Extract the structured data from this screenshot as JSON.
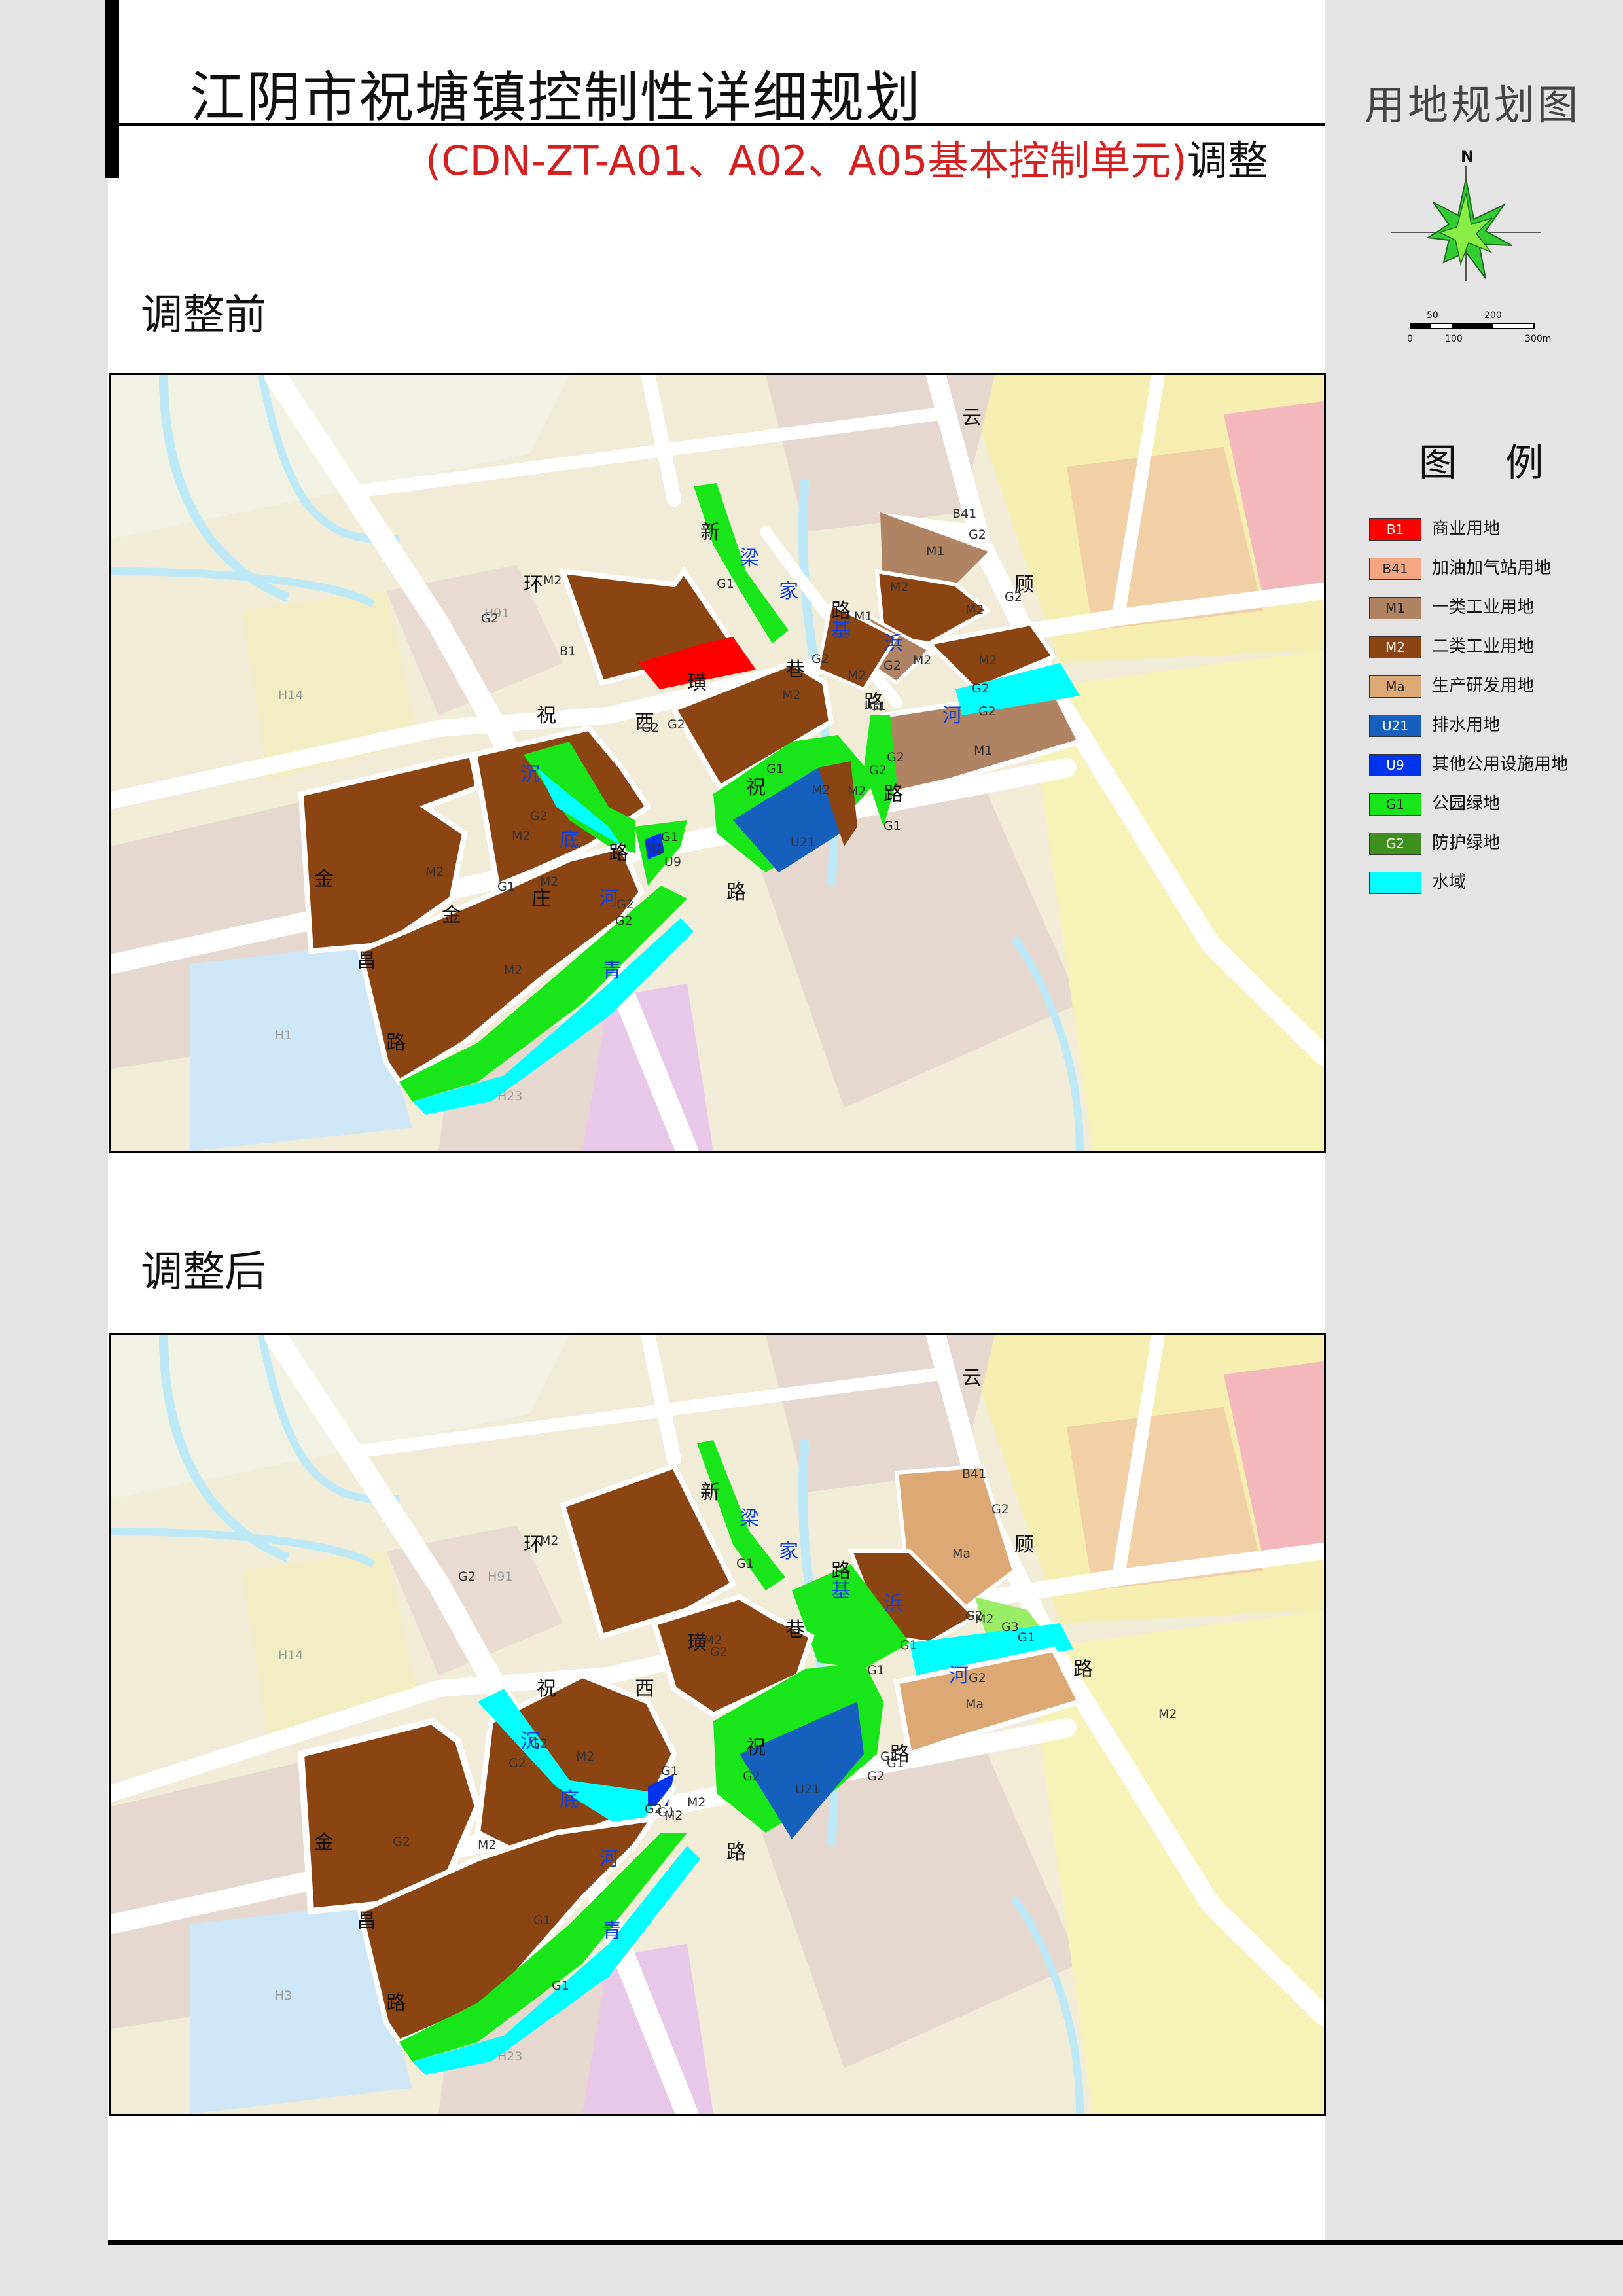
{
  "header": {
    "title": "江阴市祝塘镇控制性详细规划",
    "sheet_type": "用地规划图",
    "subtitle_red": "(CDN-ZT-A01、A02、A05基本控制单元)",
    "subtitle_black": "调整"
  },
  "sections": {
    "before": "调整前",
    "after": "调整后"
  },
  "compass": {
    "north": "N"
  },
  "scale_bar": {
    "top_labels": [
      "50",
      "200"
    ],
    "bottom_labels": [
      "0",
      "100",
      "300m"
    ]
  },
  "legend": {
    "title": "图 例",
    "items": [
      {
        "code": "B1",
        "label": "商业用地",
        "color": "#ff0000",
        "text_color": "#ffffff"
      },
      {
        "code": "B41",
        "label": "加油加气站用地",
        "color": "#f4a582",
        "text_color": "#222222"
      },
      {
        "code": "M1",
        "label": "一类工业用地",
        "color": "#b08462",
        "text_color": "#222222"
      },
      {
        "code": "M2",
        "label": "二类工业用地",
        "color": "#8b4513",
        "text_color": "#ffffff"
      },
      {
        "code": "Ma",
        "label": "生产研发用地",
        "color": "#dca874",
        "text_color": "#222222"
      },
      {
        "code": "U21",
        "label": "排水用地",
        "color": "#1560bd",
        "text_color": "#ffffff"
      },
      {
        "code": "U9",
        "label": "其他公用设施用地",
        "color": "#0033ee",
        "text_color": "#ffffff"
      },
      {
        "code": "G1",
        "label": "公园绿地",
        "color": "#19e619",
        "text_color": "#222222"
      },
      {
        "code": "G2",
        "label": "防护绿地",
        "color": "#3f8f1f",
        "text_color": "#ffffff"
      },
      {
        "code": "",
        "label": "水域",
        "color": "#00ffff",
        "text_color": "#222222"
      }
    ]
  },
  "map_before": {
    "road_chars": [
      {
        "t": "云"
      },
      {
        "t": "新"
      },
      {
        "t": "环"
      },
      {
        "t": "梁"
      },
      {
        "t": "家"
      },
      {
        "t": "路"
      },
      {
        "t": "顾"
      },
      {
        "t": "基"
      },
      {
        "t": "巷"
      },
      {
        "t": "浜"
      },
      {
        "t": "璜"
      },
      {
        "t": "路"
      },
      {
        "t": "河"
      },
      {
        "t": "祝"
      },
      {
        "t": "西"
      },
      {
        "t": "沉"
      },
      {
        "t": "祝"
      },
      {
        "t": "路"
      },
      {
        "t": "底"
      },
      {
        "t": "路"
      },
      {
        "t": "河"
      },
      {
        "t": "金"
      },
      {
        "t": "庄"
      },
      {
        "t": "路"
      },
      {
        "t": "金"
      },
      {
        "t": "昌"
      },
      {
        "t": "青"
      },
      {
        "t": "路"
      }
    ],
    "land_codes": [
      {
        "t": "M2"
      },
      {
        "t": "G2"
      },
      {
        "t": "B1"
      },
      {
        "t": "G1"
      },
      {
        "t": "B41"
      },
      {
        "t": "G2"
      },
      {
        "t": "M1"
      },
      {
        "t": "M2"
      },
      {
        "t": "G2"
      },
      {
        "t": "M1"
      },
      {
        "t": "M2"
      },
      {
        "t": "M2"
      },
      {
        "t": "G2"
      },
      {
        "t": "M2"
      },
      {
        "t": "G2"
      },
      {
        "t": "M2"
      },
      {
        "t": "G2"
      },
      {
        "t": "M2"
      },
      {
        "t": "G2"
      },
      {
        "t": "G2"
      },
      {
        "t": "G1"
      },
      {
        "t": "G2"
      },
      {
        "t": "M1"
      },
      {
        "t": "G1"
      },
      {
        "t": "M2"
      },
      {
        "t": "G2"
      },
      {
        "t": "G2"
      },
      {
        "t": "M2"
      },
      {
        "t": "G1"
      },
      {
        "t": "U21"
      },
      {
        "t": "G2"
      },
      {
        "t": "M2"
      },
      {
        "t": "G1"
      },
      {
        "t": "M2"
      },
      {
        "t": "M2"
      },
      {
        "t": "G2"
      },
      {
        "t": "M2"
      },
      {
        "t": "G1"
      },
      {
        "t": "U9"
      },
      {
        "t": "G2"
      },
      {
        "t": "M2"
      },
      {
        "t": "H91"
      },
      {
        "t": "H14"
      },
      {
        "t": "H1"
      },
      {
        "t": "H23"
      }
    ]
  },
  "map_after": {
    "road_chars": [
      {
        "t": "云"
      },
      {
        "t": "新"
      },
      {
        "t": "环"
      },
      {
        "t": "梁"
      },
      {
        "t": "家"
      },
      {
        "t": "路"
      },
      {
        "t": "顾"
      },
      {
        "t": "基"
      },
      {
        "t": "巷"
      },
      {
        "t": "浜"
      },
      {
        "t": "璜"
      },
      {
        "t": "河"
      },
      {
        "t": "路"
      },
      {
        "t": "祝"
      },
      {
        "t": "西"
      },
      {
        "t": "沉"
      },
      {
        "t": "祝"
      },
      {
        "t": "路"
      },
      {
        "t": "底"
      },
      {
        "t": "路"
      },
      {
        "t": "河"
      },
      {
        "t": "金"
      },
      {
        "t": "昌"
      },
      {
        "t": "青"
      },
      {
        "t": "路"
      }
    ],
    "land_codes": [
      {
        "t": "M2"
      },
      {
        "t": "G2"
      },
      {
        "t": "G1"
      },
      {
        "t": "B41"
      },
      {
        "t": "G2"
      },
      {
        "t": "Ma"
      },
      {
        "t": "G2"
      },
      {
        "t": "M2"
      },
      {
        "t": "G3"
      },
      {
        "t": "G1"
      },
      {
        "t": "G1"
      },
      {
        "t": "M2"
      },
      {
        "t": "G2"
      },
      {
        "t": "G1"
      },
      {
        "t": "G2"
      },
      {
        "t": "Ma"
      },
      {
        "t": "M2"
      },
      {
        "t": "G2"
      },
      {
        "t": "G2"
      },
      {
        "t": "M2"
      },
      {
        "t": "G2"
      },
      {
        "t": "G1"
      },
      {
        "t": "G1"
      },
      {
        "t": "U21"
      },
      {
        "t": "G2"
      },
      {
        "t": "G2"
      },
      {
        "t": "G1"
      },
      {
        "t": "M2"
      },
      {
        "t": "G2"
      },
      {
        "t": "M2"
      },
      {
        "t": "G2"
      },
      {
        "t": "M2"
      },
      {
        "t": "G1"
      },
      {
        "t": "G1"
      },
      {
        "t": "H91"
      },
      {
        "t": "H14"
      },
      {
        "t": "H3"
      },
      {
        "t": "H23"
      }
    ]
  }
}
